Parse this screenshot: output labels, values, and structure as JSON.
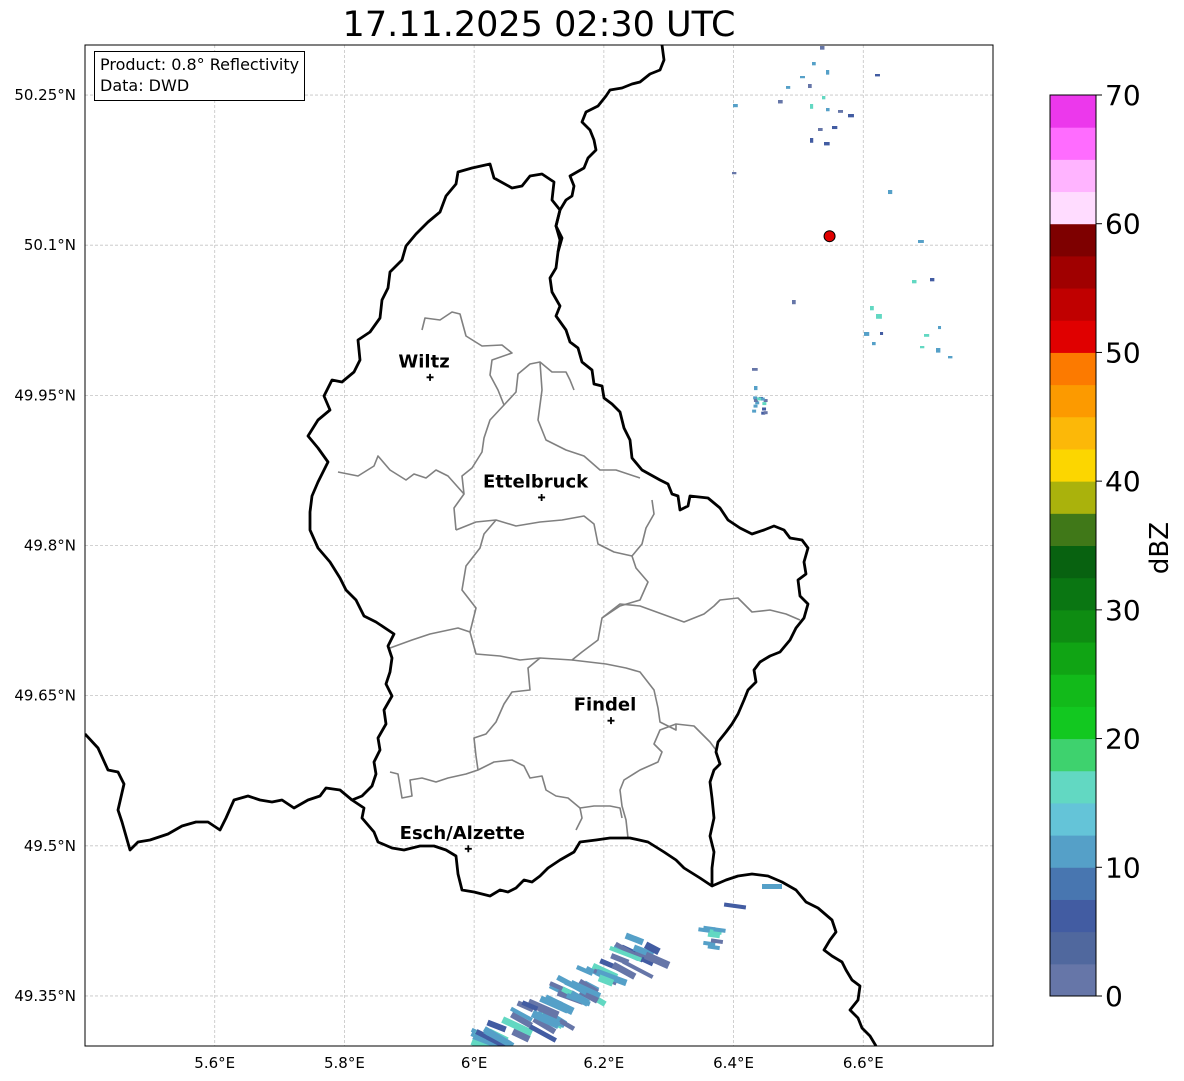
{
  "title": "17.11.2025 02:30 UTC",
  "info": {
    "product": "Product: 0.8° Reflectivity",
    "data": "Data: DWD"
  },
  "map": {
    "lon_range": [
      5.4,
      6.8
    ],
    "lat_range": [
      49.3,
      50.3
    ],
    "lon_ticks": [
      {
        "value": 5.6,
        "label": "5.6°E"
      },
      {
        "value": 5.8,
        "label": "5.8°E"
      },
      {
        "value": 6.0,
        "label": "6°E"
      },
      {
        "value": 6.2,
        "label": "6.2°E"
      },
      {
        "value": 6.4,
        "label": "6.4°E"
      },
      {
        "value": 6.6,
        "label": "6.6°E"
      }
    ],
    "lat_ticks": [
      {
        "value": 50.25,
        "label": "50.25°N"
      },
      {
        "value": 50.1,
        "label": "50.1°N"
      },
      {
        "value": 49.95,
        "label": "49.95°N"
      },
      {
        "value": 49.8,
        "label": "49.8°N"
      },
      {
        "value": 49.65,
        "label": "49.65°N"
      },
      {
        "value": 49.5,
        "label": "49.5°N"
      },
      {
        "value": 49.35,
        "label": "49.35°N"
      }
    ],
    "gridlines": true
  },
  "cities": [
    {
      "name": "Wiltz",
      "lon": 5.932,
      "lat": 49.968
    },
    {
      "name": "Ettelbruck",
      "lon": 6.104,
      "lat": 49.848
    },
    {
      "name": "Findel",
      "lon": 6.211,
      "lat": 49.625
    },
    {
      "name": "Esch/Alzette",
      "lon": 5.991,
      "lat": 49.497
    }
  ],
  "radar_site": {
    "lon": 6.548,
    "lat": 50.109,
    "color": "#e00000"
  },
  "colorbar": {
    "label": "dBZ",
    "min": 0,
    "max": 70,
    "step": 2.5,
    "tick_values": [
      0,
      10,
      20,
      30,
      40,
      50,
      60,
      70
    ],
    "tick_labels": [
      "0",
      "10",
      "20",
      "30",
      "40",
      "50",
      "60",
      "70"
    ],
    "colors": [
      "#6676a8",
      "#50689e",
      "#425ca2",
      "#4876b0",
      "#55a0c8",
      "#64c4d8",
      "#62d8c2",
      "#3ed26e",
      "#12c820",
      "#12ba1a",
      "#10a414",
      "#0e8c12",
      "#0a7612",
      "#086210",
      "#407818",
      "#aab20c",
      "#fcd600",
      "#fcb808",
      "#fc9a00",
      "#fc7a00",
      "#e00000",
      "#c00000",
      "#a00000",
      "#7e0000",
      "#ffdcff",
      "#ffb4ff",
      "#ff6cff",
      "#ec38ec"
    ]
  },
  "echo_dbz": [
    0,
    5,
    10,
    12,
    15
  ]
}
